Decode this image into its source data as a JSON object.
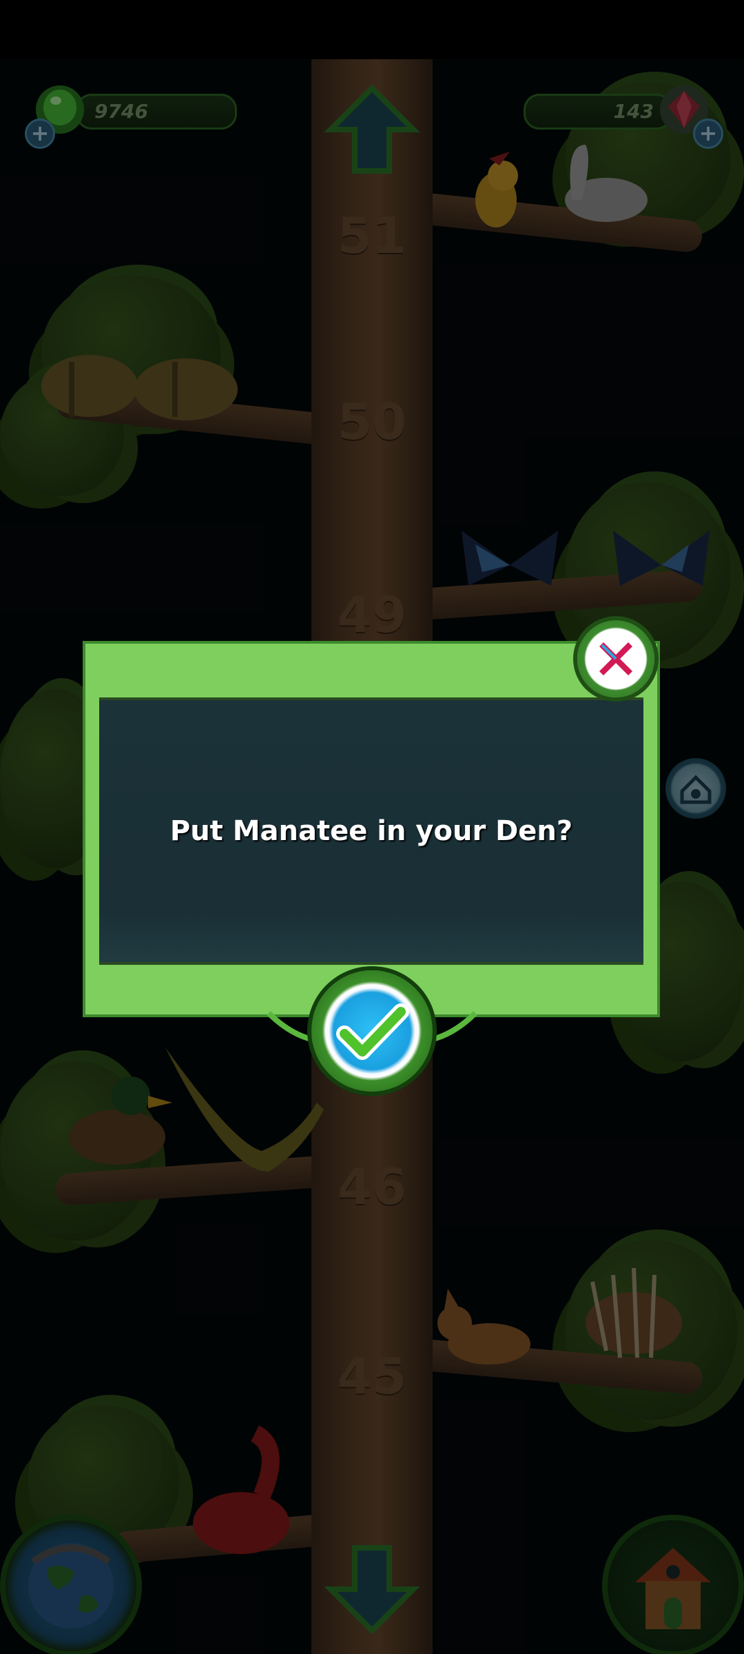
{
  "resources": {
    "leaves": "9746",
    "gems": "143"
  },
  "tree": {
    "levels": [
      "51",
      "50",
      "49",
      "46",
      "45"
    ]
  },
  "dialog": {
    "message": "Put Manatee in your Den?"
  },
  "icons": {
    "top_left": "green-leaf-icon",
    "top_right": "gem-icon",
    "close": "close-icon",
    "confirm": "checkmark-icon",
    "den": "den-icon",
    "globe": "globe-icon",
    "home": "house-icon",
    "up": "up-arrow-icon",
    "down": "down-arrow-icon"
  },
  "colors": {
    "dialog_frame": "#7ecf5e",
    "dialog_body": "#1b3238",
    "message_text": "#ffffff"
  }
}
